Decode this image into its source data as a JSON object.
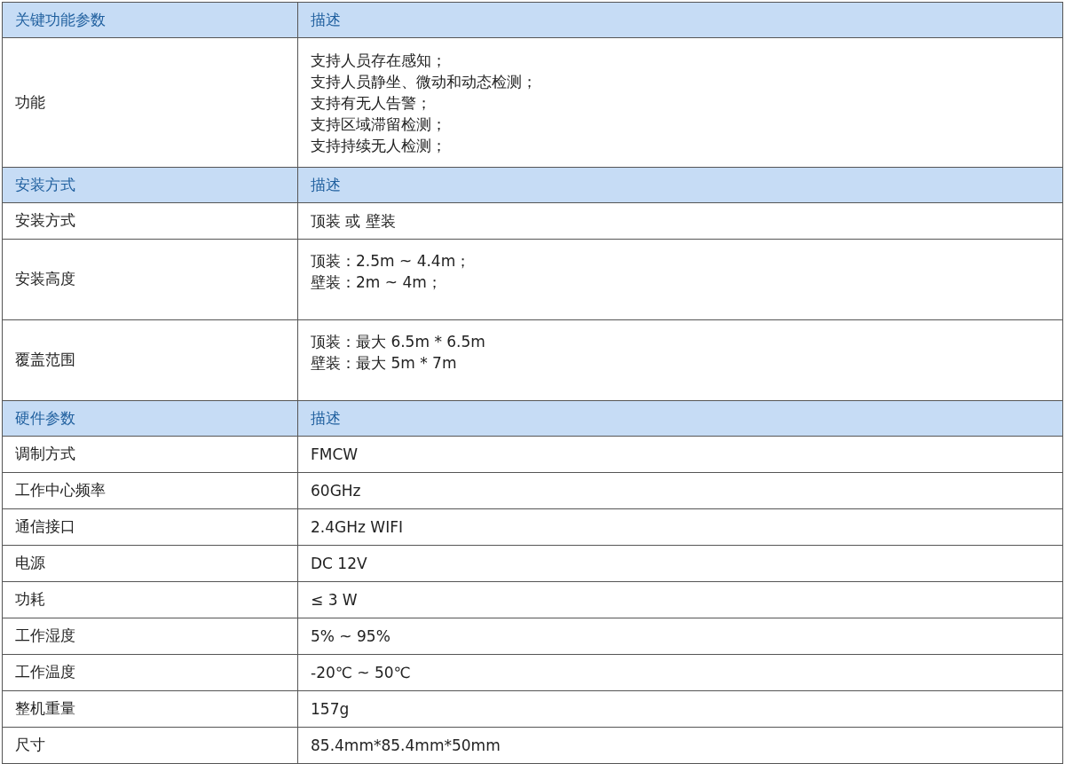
{
  "sections": [
    {
      "header": [
        "关键功能参数",
        "描述"
      ],
      "rows": [
        {
          "label": "功能",
          "lines": [
            "支持人员存在感知；",
            "支持人员静坐、微动和动态检测；",
            "支持有无人告警；",
            "支持区域滞留检测；",
            "支持持续无人检测；"
          ]
        }
      ]
    },
    {
      "header": [
        "安装方式",
        "描述"
      ],
      "rows": [
        {
          "label": "安装方式",
          "lines": [
            "顶装 或 壁装"
          ]
        },
        {
          "label": "安装高度",
          "lines": [
            "顶装：2.5m ~ 4.4m；",
            "壁装：2m ~ 4m；"
          ]
        },
        {
          "label": "覆盖范围",
          "lines": [
            "顶装：最大 6.5m * 6.5m",
            "壁装：最大 5m * 7m"
          ]
        }
      ]
    },
    {
      "header": [
        "硬件参数",
        "描述"
      ],
      "rows": [
        {
          "label": "调制方式",
          "lines": [
            "FMCW"
          ]
        },
        {
          "label": "工作中心频率",
          "lines": [
            "60GHz"
          ]
        },
        {
          "label": "通信接口",
          "lines": [
            "2.4GHz WIFI"
          ]
        },
        {
          "label": "电源",
          "lines": [
            "DC 12V"
          ]
        },
        {
          "label": "功耗",
          "lines": [
            "≤ 3 W"
          ]
        },
        {
          "label": "工作湿度",
          "lines": [
            "5% ~ 95%"
          ]
        },
        {
          "label": "工作温度",
          "lines": [
            "-20℃ ~ 50℃"
          ]
        },
        {
          "label": "整机重量",
          "lines": [
            "157g"
          ]
        },
        {
          "label": "尺寸",
          "lines": [
            "85.4mm*85.4mm*50mm"
          ]
        }
      ]
    }
  ]
}
